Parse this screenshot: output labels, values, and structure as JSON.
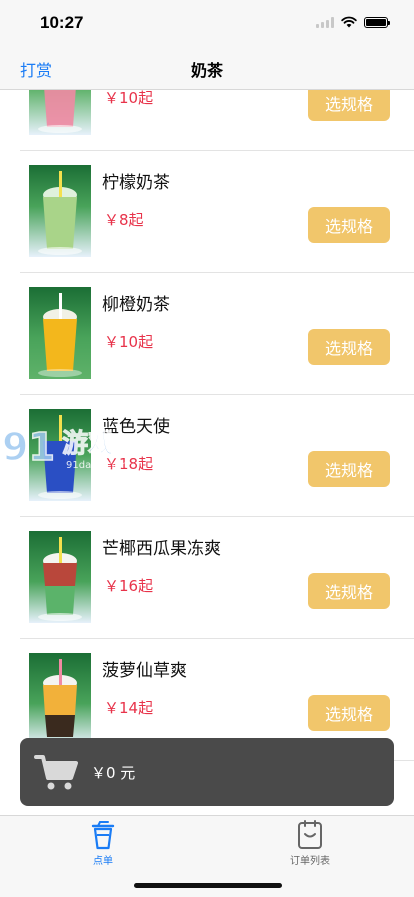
{
  "status_bar": {
    "time": "10:27"
  },
  "nav": {
    "left_label": "打赏",
    "title": "奶茶"
  },
  "products": [
    {
      "name": "",
      "price": "￥10起",
      "button": "选规格"
    },
    {
      "name": "柠檬奶茶",
      "price": "￥8起",
      "button": "选规格"
    },
    {
      "name": "柳橙奶茶",
      "price": "￥10起",
      "button": "选规格"
    },
    {
      "name": "蓝色天使",
      "price": "￥18起",
      "button": "选规格"
    },
    {
      "name": "芒椰西瓜果冻爽",
      "price": "￥16起",
      "button": "选规格"
    },
    {
      "name": "菠萝仙草爽",
      "price": "￥14起",
      "button": "选规格"
    }
  ],
  "cart": {
    "total": "￥0 元"
  },
  "tabs": [
    {
      "label": "点单",
      "icon": "cup-icon",
      "active": true
    },
    {
      "label": "订单列表",
      "icon": "order-list-icon",
      "active": false
    }
  ],
  "watermark": {
    "text": "91游戏",
    "url": "91danji.com"
  },
  "colors": {
    "accent": "#1a7cf5",
    "price": "#e8334a",
    "button": "#f1c66b",
    "cart_bar": "#4a4a4a"
  }
}
